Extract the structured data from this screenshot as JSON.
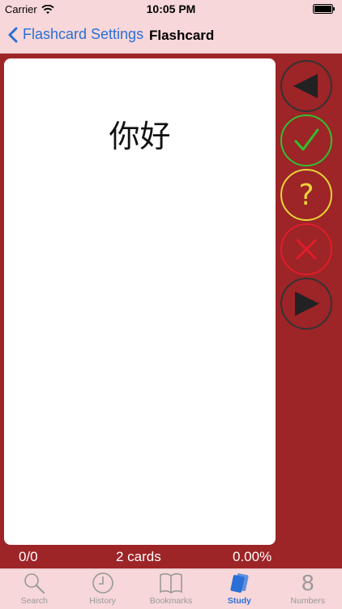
{
  "status_bar": {
    "carrier": "Carrier",
    "time": "10:05 PM"
  },
  "nav": {
    "back_label": "Flashcard Settings",
    "title": "Flashcard"
  },
  "card": {
    "word": "你好"
  },
  "controls": {
    "items": [
      {
        "name": "previous-button",
        "icon": "left-triangle-icon"
      },
      {
        "name": "correct-button",
        "icon": "check-icon",
        "color": "#30c030"
      },
      {
        "name": "unsure-button",
        "icon": "question-icon",
        "color": "#e8d43a"
      },
      {
        "name": "incorrect-button",
        "icon": "x-icon",
        "color": "#e01d2a"
      },
      {
        "name": "next-button",
        "icon": "right-triangle-icon"
      }
    ]
  },
  "summary": {
    "progress": "0/0",
    "cards": "2 cards",
    "percent": "0.00%"
  },
  "tabs": [
    {
      "label": "Search",
      "icon": "search-icon"
    },
    {
      "label": "History",
      "icon": "clock-icon"
    },
    {
      "label": "Bookmarks",
      "icon": "book-icon"
    },
    {
      "label": "Study",
      "icon": "cards-icon",
      "active": true
    },
    {
      "label": "Numbers",
      "icon": "number-eight-icon",
      "glyph": "8"
    }
  ],
  "colors": {
    "accent": "#2a6fd6",
    "background": "#9d2427",
    "bar": "#f7d7d9"
  }
}
